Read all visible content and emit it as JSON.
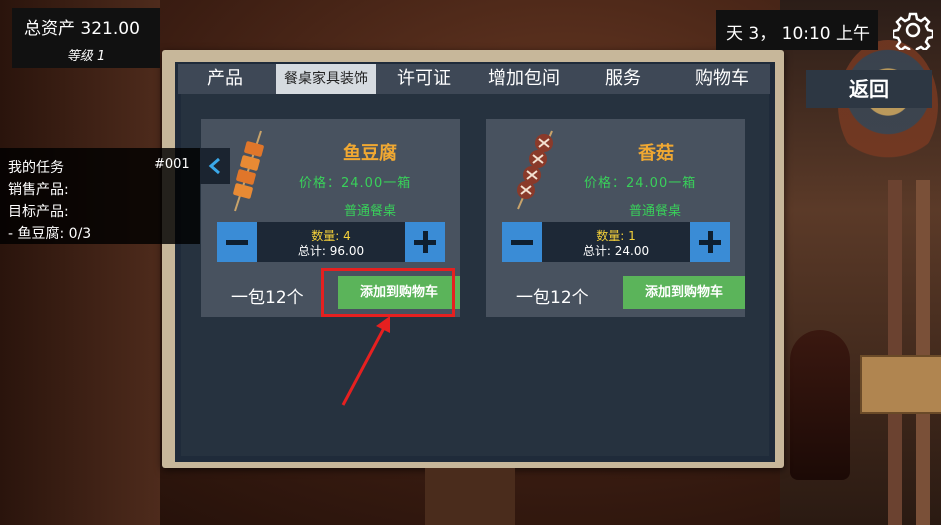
{
  "hud": {
    "total_assets_label": "总资产",
    "total_assets_value": "321.00",
    "level_label": "等级",
    "level_value": "1",
    "time_text": "天 3，  10:10 上午"
  },
  "back_button": "返回",
  "tabs": [
    {
      "label": "产品",
      "active": false
    },
    {
      "label": "餐桌家具装饰",
      "active": true
    },
    {
      "label": "许可证",
      "active": false
    },
    {
      "label": "增加包间",
      "active": false
    },
    {
      "label": "服务",
      "active": false
    },
    {
      "label": "购物车",
      "active": false
    }
  ],
  "mission": {
    "title": "我的任务",
    "id": "#001",
    "sell_label": "销售产品:",
    "target_label": "目标产品:",
    "progress": "- 鱼豆腐: 0/3"
  },
  "products": [
    {
      "name": "鱼豆腐",
      "price": "价格：24.00一箱",
      "table": "普通餐桌",
      "quantity": "数量: 4",
      "total": "总计: 96.00",
      "pack": "一包12个",
      "add_button": "添加到购物车",
      "icon": "fish-tofu-skewer-icon"
    },
    {
      "name": "香菇",
      "price": "价格：24.00一箱",
      "table": "普通餐桌",
      "quantity": "数量: 1",
      "total": "总计: 24.00",
      "pack": "一包12个",
      "add_button": "添加到购物车",
      "icon": "mushroom-skewer-icon"
    }
  ],
  "colors": {
    "accent_button": "#5bb45a",
    "product_name": "#f0a832",
    "price_text": "#39d05a",
    "quantity_text": "#f5d13a",
    "stepper": "#3a8cd6",
    "highlight": "#e62020"
  }
}
